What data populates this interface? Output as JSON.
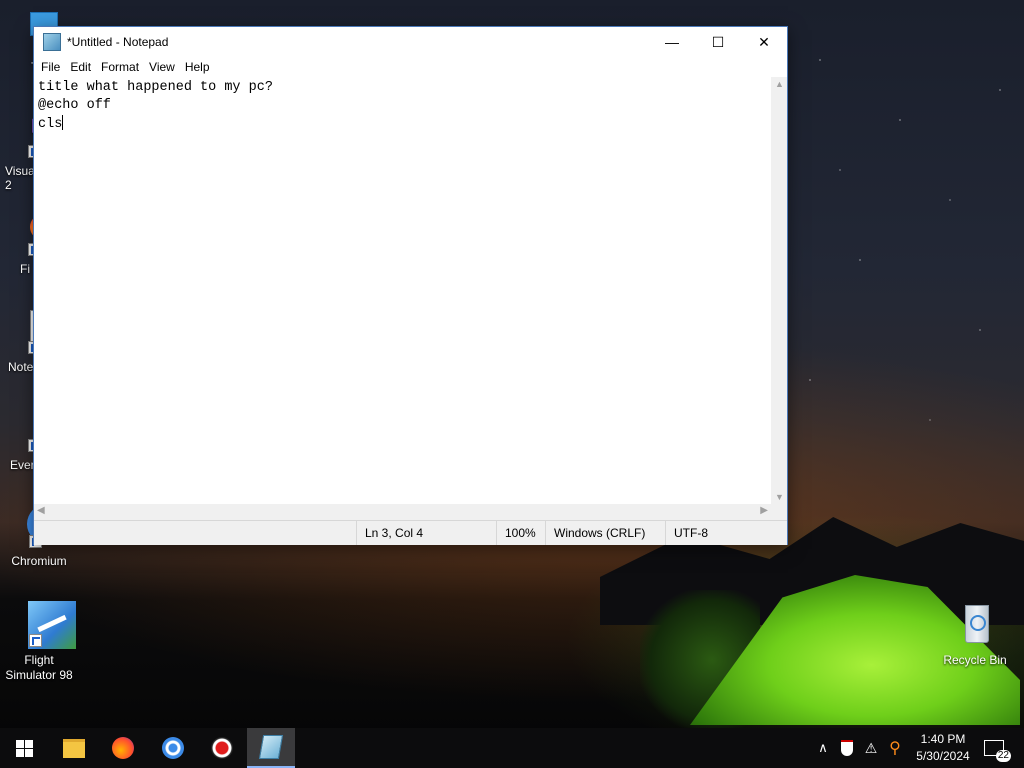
{
  "desktop": {
    "icons": [
      {
        "label": "Th",
        "icon": "this-pc-icon"
      },
      {
        "label": "Visua\n2",
        "icon": "visual-studio-icon"
      },
      {
        "label": "Fi",
        "icon": "firefox-icon"
      },
      {
        "label": "Note",
        "icon": "notepad-plus-plus-icon"
      },
      {
        "label": "Ever",
        "icon": "everything-icon"
      },
      {
        "label": "Chromium",
        "icon": "chromium-icon"
      },
      {
        "label": "Flight\nSimulator 98",
        "icon": "flight-simulator-icon"
      },
      {
        "label": "Recycle Bin",
        "icon": "recycle-bin-icon"
      }
    ]
  },
  "notepad": {
    "title": "*Untitled - Notepad",
    "menu": [
      "File",
      "Edit",
      "Format",
      "View",
      "Help"
    ],
    "content": "title what happened to my pc?\n@echo off\ncls",
    "status": {
      "position": "Ln 3, Col 4",
      "zoom": "100%",
      "line_ending": "Windows (CRLF)",
      "encoding": "UTF-8"
    }
  },
  "taskbar": {
    "apps": [
      "start-icon",
      "file-explorer-icon",
      "firefox-icon",
      "chromium-icon",
      "recorder-icon",
      "notepad-icon"
    ],
    "time": "1:40 PM",
    "date": "5/30/2024",
    "notification_count": "22"
  }
}
